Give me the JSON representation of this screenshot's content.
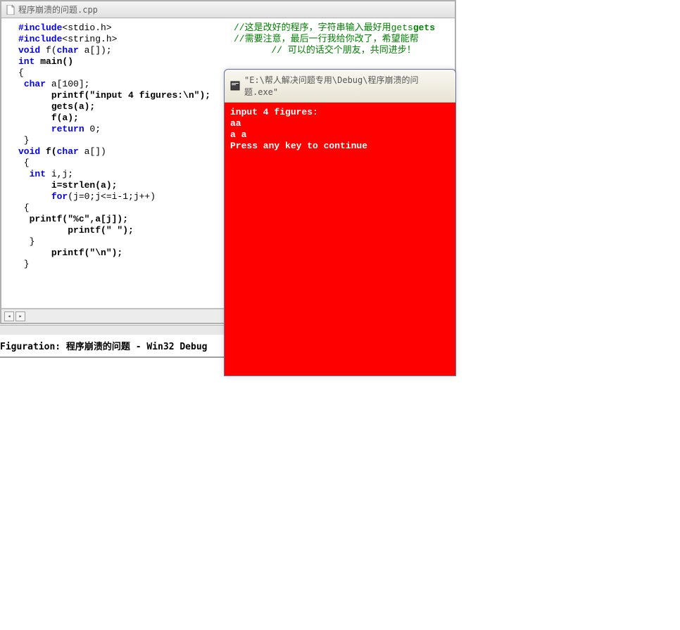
{
  "editor": {
    "title": "程序崩溃的问题.cpp",
    "code_lines": [
      {
        "type": "include",
        "directive": "#include",
        "text": "<stdio.h>"
      },
      {
        "type": "include",
        "directive": "#include",
        "text": "<string.h>"
      },
      {
        "type": "decl",
        "kw": "void",
        "rest": " f(",
        "kw2": "char",
        "rest2": " a[]);"
      },
      {
        "type": "decl",
        "kw": "int",
        "rest": " main()"
      },
      {
        "type": "brace",
        "text": "{"
      },
      {
        "type": "decl2",
        "indent": " ",
        "kw": "char",
        "rest": " a[100];"
      },
      {
        "type": "stmt",
        "indent": "      ",
        "text": "printf(\"input 4 figures:\\n\");"
      },
      {
        "type": "stmt",
        "indent": "      ",
        "text": "gets(a);"
      },
      {
        "type": "stmt",
        "indent": "      ",
        "text": "f(a);"
      },
      {
        "type": "ret",
        "indent": "      ",
        "kw": "return",
        "rest": " 0;"
      },
      {
        "type": "brace",
        "text": " }"
      },
      {
        "type": "decl3",
        "kw": "void",
        "rest": " f(",
        "kw2": "char",
        "rest2": " a[])"
      },
      {
        "type": "brace",
        "text": " {"
      },
      {
        "type": "decl2",
        "indent": "  ",
        "kw": "int",
        "rest": " i,j;"
      },
      {
        "type": "stmt",
        "indent": "      ",
        "text": "i=strlen(a);"
      },
      {
        "type": "for",
        "indent": "      ",
        "kw": "for",
        "rest": "(j=0;j<=i-1;j++)"
      },
      {
        "type": "brace",
        "text": " {"
      },
      {
        "type": "stmt",
        "indent": "  ",
        "text": "printf(\"%c\",a[j]);"
      },
      {
        "type": "stmt",
        "indent": "         ",
        "text": "printf(\" \");"
      },
      {
        "type": "brace",
        "text": "  }"
      },
      {
        "type": "stmt",
        "indent": "      ",
        "text": "printf(\"\\n\");"
      },
      {
        "type": "brace",
        "text": " }"
      }
    ],
    "comments": [
      "//这是改好的程序，字符串输入最好用gets",
      "//需要注意，最后一行我给你改了，希望能帮",
      "   // 可以的话交个朋友，共同进步！"
    ]
  },
  "output_panel": {
    "text": "Figuration: 程序崩溃的问题 - Win32 Debug"
  },
  "console": {
    "title": "\"E:\\帮人解决问题专用\\Debug\\程序崩溃的问题.exe\"",
    "lines": [
      "input 4 figures:",
      "aa",
      "a a",
      "Press any key to continue"
    ]
  },
  "scroll": {
    "left_arrow": "◂",
    "right_arrow": "▸"
  }
}
